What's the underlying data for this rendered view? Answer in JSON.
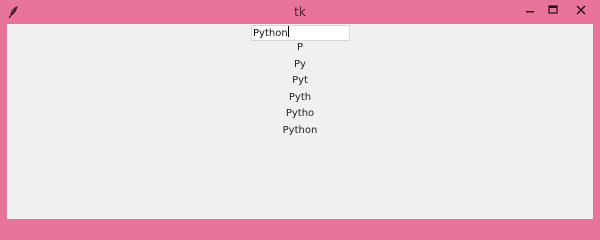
{
  "window": {
    "title": "tk"
  },
  "entry": {
    "value": "Python"
  },
  "labels": [
    "P",
    "Py",
    "Pyt",
    "Pyth",
    "Pytho",
    "Python"
  ]
}
